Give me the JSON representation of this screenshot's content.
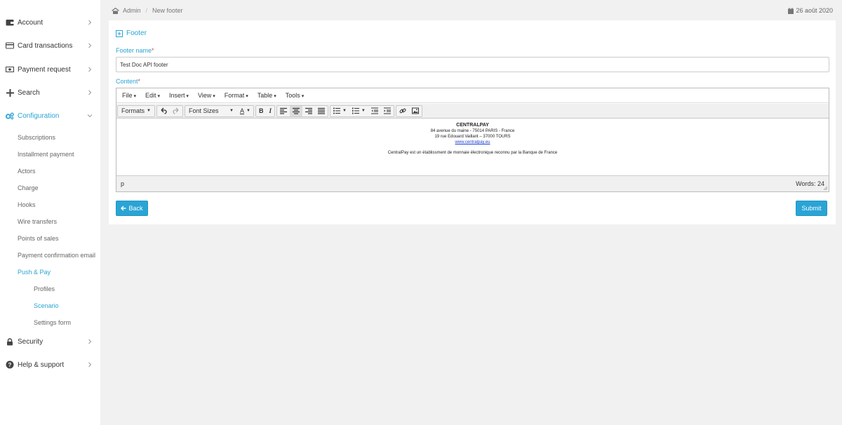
{
  "breadcrumb": {
    "root": "Admin",
    "current": "New footer"
  },
  "date": "26 août 2020",
  "sidebar": {
    "items": [
      {
        "label": "Account",
        "icon": "wallet-icon"
      },
      {
        "label": "Card transactions",
        "icon": "credit-card-icon"
      },
      {
        "label": "Payment request",
        "icon": "banknote-icon"
      },
      {
        "label": "Search",
        "icon": "plus-icon"
      },
      {
        "label": "Configuration",
        "icon": "cogs-icon"
      },
      {
        "label": "Security",
        "icon": "lock-icon"
      },
      {
        "label": "Help & support",
        "icon": "question-circle-icon"
      }
    ],
    "config_sub": [
      "Subscriptions",
      "Installment payment",
      "Actors",
      "Charge",
      "Hooks",
      "Wire transfers",
      "Points of sales",
      "Payment confirmation email",
      "Push & Pay"
    ],
    "push_pay_sub": [
      "Profiles",
      "Scenario",
      "Settings form"
    ]
  },
  "form": {
    "title": "Footer",
    "name_label": "Footer name",
    "required_mark": "*",
    "name_value": "Test Doc API footer",
    "content_label": "Content"
  },
  "editor": {
    "menus": [
      "File",
      "Edit",
      "Insert",
      "View",
      "Format",
      "Table",
      "Tools"
    ],
    "formats_label": "Formats",
    "font_sizes_label": "Font Sizes",
    "font_color_label": "A",
    "bold_label": "B",
    "italic_label": "I",
    "content": {
      "line1": "CENTRALPAY",
      "line2": "84 avenue du maine - 75014 PARIS - France",
      "line3": "19 rue Edouard Vaillant – 37000 TOURS",
      "link": "www.centralpay.eu",
      "line5": "CentralPay est un établissment de monnaie électronique reconnu par la Banque de France"
    },
    "status_path": "p",
    "word_count": "Words: 24"
  },
  "buttons": {
    "back": "Back",
    "submit": "Submit"
  },
  "colors": {
    "accent": "#2aa4d5",
    "required": "#d9534f",
    "background": "#f1f1f1"
  }
}
